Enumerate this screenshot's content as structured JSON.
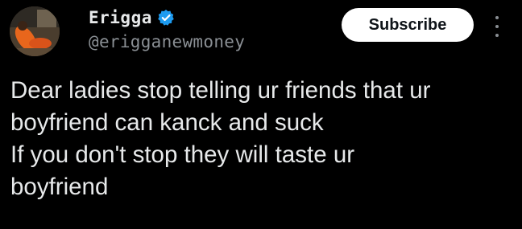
{
  "author": {
    "display_name": "Erigga",
    "handle": "@erigganewmoney",
    "verified": true,
    "avatar": "profile-photo-person-lying-orange-outfit"
  },
  "actions": {
    "subscribe_label": "Subscribe",
    "more_icon": "vertical-ellipsis-icon"
  },
  "post": {
    "lines": [
      "Dear ladies stop telling ur friends that ur",
      "boyfriend can kanck and suck",
      "If you don't stop they will taste ur",
      "boyfriend"
    ]
  },
  "colors": {
    "background": "#000000",
    "text": "#e7e9ea",
    "secondary_text": "#8a8f94",
    "verified_badge": "#1d9bf0",
    "subscribe_bg": "#ffffff",
    "subscribe_text": "#0f1419"
  }
}
